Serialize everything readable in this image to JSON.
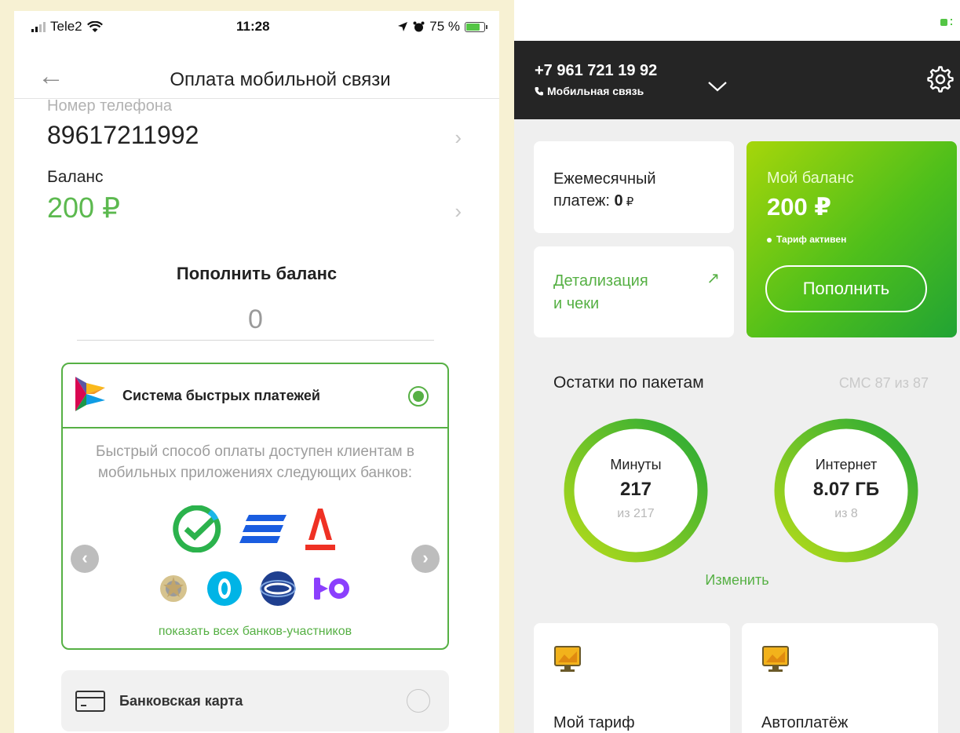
{
  "left": {
    "status_bar": {
      "carrier": "Tele2",
      "time": "11:28",
      "battery": "75 %"
    },
    "nav": {
      "title": "Оплата мобильной связи"
    },
    "phone": {
      "label": "Номер телефона",
      "value": "89617211992"
    },
    "balance": {
      "label": "Баланс",
      "value": "200 ₽"
    },
    "topup": {
      "label": "Пополнить баланс",
      "value": "0"
    },
    "sbp": {
      "title": "Система быстрых платежей",
      "selected": true,
      "description": "Быстрый способ оплаты доступен клиентам в мобильных приложениях следующих банков:",
      "banks": [
        "sber-icon",
        "vtb-icon",
        "alfa-icon",
        "rshb-icon",
        "otkritie-icon",
        "gazprombank-icon",
        "yoomoney-icon"
      ],
      "show_all_link": "показать всех банков-участников"
    },
    "card_option": {
      "label": "Банковская карта",
      "selected": false
    }
  },
  "right": {
    "header": {
      "phone": "+7 961 721 19 92",
      "service": "Мобильная связь"
    },
    "monthly": {
      "label_line1": "Ежемесячный",
      "label_line2": "платеж: ",
      "amount": "0",
      "currency": " ₽"
    },
    "details": {
      "line1": "Детализация",
      "line2": "и чеки"
    },
    "balance": {
      "label": "Мой баланс",
      "value": "200 ₽",
      "status": "Тариф активен",
      "button": "Пополнить"
    },
    "packages": {
      "label": "Остатки по пакетам",
      "sms": "СМС 87 из 87",
      "minutes": {
        "title": "Минуты",
        "value": "217",
        "of": "из 217",
        "fraction": 1.0
      },
      "internet": {
        "title": "Интернет",
        "value": "8.07 ГБ",
        "of": "из 8",
        "fraction": 1.0
      },
      "change_link": "Изменить"
    },
    "tiles": {
      "tariff": "Мой тариф",
      "autopay": "Автоплатёж"
    },
    "colors": {
      "accent": "#56b044",
      "header_bg": "#252525",
      "balance_gradient_start": "#a6d60a",
      "balance_gradient_end": "#21a334"
    }
  }
}
